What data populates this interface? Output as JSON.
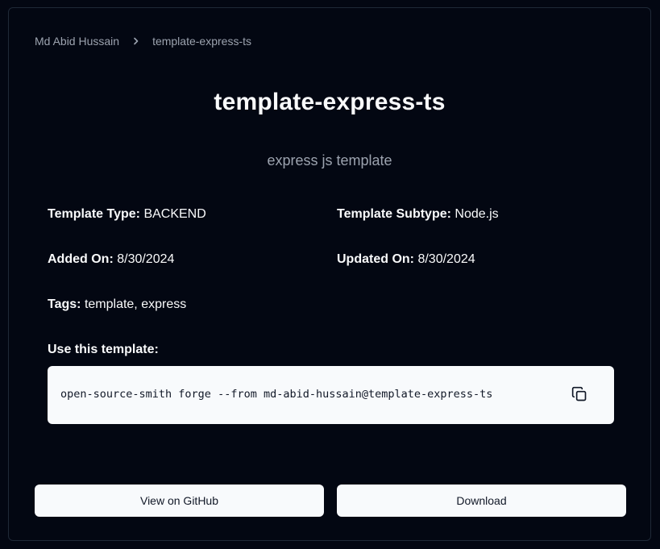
{
  "breadcrumb": {
    "owner": "Md Abid Hussain",
    "current": "template-express-ts"
  },
  "template": {
    "name": "template-express-ts",
    "description": "express js template"
  },
  "meta": {
    "type_label": "Template Type:",
    "type_value": "BACKEND",
    "subtype_label": "Template Subtype:",
    "subtype_value": "Node.js",
    "added_label": "Added On:",
    "added_value": "8/30/2024",
    "updated_label": "Updated On:",
    "updated_value": "8/30/2024",
    "tags_label": "Tags:",
    "tags_value": "template, express"
  },
  "usage": {
    "label": "Use this template:",
    "command": "open-source-smith forge --from md-abid-hussain@template-express-ts",
    "copy_icon": "copy-icon"
  },
  "actions": {
    "github_label": "View on GitHub",
    "download_label": "Download"
  },
  "colors": {
    "background": "#030712",
    "border": "#1f2937",
    "muted_text": "#9ca3af",
    "light_surface": "#f8fafc"
  }
}
